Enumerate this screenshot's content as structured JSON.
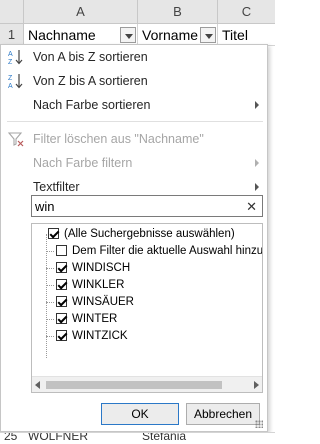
{
  "columns": {
    "row_header": "",
    "a": "A",
    "b": "B",
    "c": "C"
  },
  "row1": {
    "num": "1",
    "nachname": "Nachname",
    "vorname": "Vorname",
    "titel": "Titel"
  },
  "menu": {
    "sort_az": "Von A bis Z sortieren",
    "sort_za": "Von Z bis A sortieren",
    "sort_color": "Nach Farbe sortieren",
    "clear_filter": "Filter löschen aus \"Nachname\"",
    "filter_color": "Nach Farbe filtern",
    "text_filter": "Textfilter"
  },
  "search": {
    "value": "win",
    "clear_glyph": "✕"
  },
  "list": [
    {
      "label": "(Alle Suchergebnisse auswählen)",
      "checked": true
    },
    {
      "label": "Dem Filter die aktuelle Auswahl hinzu",
      "checked": false
    },
    {
      "label": "WINDISCH",
      "checked": true
    },
    {
      "label": "WINKLER",
      "checked": true
    },
    {
      "label": "WINSÄUER",
      "checked": true
    },
    {
      "label": "WINTER",
      "checked": true
    },
    {
      "label": "WINTZICK",
      "checked": true
    }
  ],
  "buttons": {
    "ok": "OK",
    "cancel": "Abbrechen"
  },
  "bottom": {
    "num": "25",
    "a": "WOLFNER",
    "b": "Stefania"
  },
  "icons": {
    "sort_az": "sort-ascending-icon",
    "sort_za": "sort-descending-icon",
    "clear_filter": "clear-filter-icon"
  },
  "colors": {
    "accent": "#2b78c7",
    "disabled": "#a6a6a6"
  }
}
